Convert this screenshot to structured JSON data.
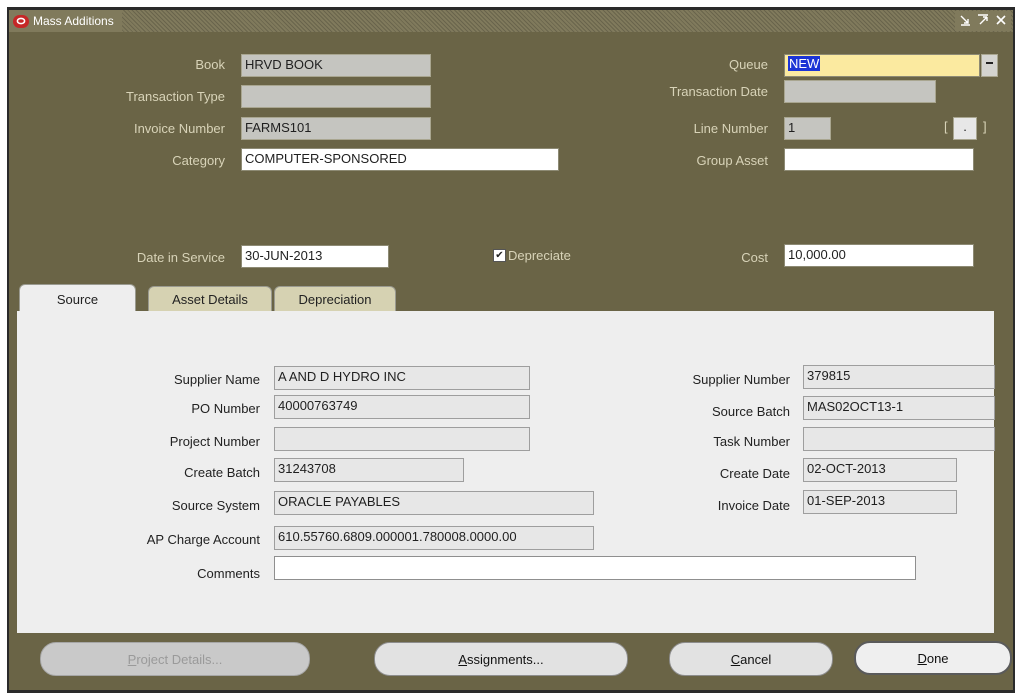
{
  "window": {
    "title": "Mass Additions",
    "controls": [
      "minimize",
      "maximize",
      "close"
    ]
  },
  "header": {
    "book_label": "Book",
    "book_value": "HRVD BOOK",
    "transaction_type_label": "Transaction Type",
    "transaction_type_value": "",
    "invoice_number_label": "Invoice Number",
    "invoice_number_value": "FARMS101",
    "category_label": "Category",
    "category_value": "COMPUTER-SPONSORED",
    "queue_label": "Queue",
    "queue_value": "NEW",
    "transaction_date_label": "Transaction Date",
    "transaction_date_value": "",
    "line_number_label": "Line Number",
    "line_number_value": "1",
    "group_asset_label": "Group Asset",
    "group_asset_value": "",
    "date_in_service_label": "Date in Service",
    "date_in_service_value": "30-JUN-2013",
    "depreciate_label": "Depreciate",
    "depreciate_checked": true,
    "cost_label": "Cost",
    "cost_value": "10,000.00"
  },
  "tabs": [
    {
      "label": "Source",
      "active": true
    },
    {
      "label": "Asset Details",
      "active": false
    },
    {
      "label": "Depreciation",
      "active": false
    }
  ],
  "source": {
    "supplier_name_label": "Supplier Name",
    "supplier_name_value": "A AND D HYDRO INC",
    "po_number_label": "PO Number",
    "po_number_value": "40000763749",
    "project_number_label": "Project Number",
    "project_number_value": "",
    "create_batch_label": "Create Batch",
    "create_batch_value": "31243708",
    "source_system_label": "Source System",
    "source_system_value": "ORACLE PAYABLES",
    "ap_charge_account_label": "AP Charge Account",
    "ap_charge_account_value": "610.55760.6809.000001.780008.0000.00",
    "comments_label": "Comments",
    "comments_value": "",
    "supplier_number_label": "Supplier Number",
    "supplier_number_value": "379815",
    "source_batch_label": "Source Batch",
    "source_batch_value": "MAS02OCT13-1",
    "task_number_label": "Task Number",
    "task_number_value": "",
    "create_date_label": "Create Date",
    "create_date_value": "02-OCT-2013",
    "invoice_date_label": "Invoice Date",
    "invoice_date_value": "01-SEP-2013"
  },
  "buttons": {
    "project_details": {
      "mnemonic": "P",
      "rest": "roject Details..."
    },
    "assignments": {
      "mnemonic": "A",
      "rest": "ssignments..."
    },
    "cancel": {
      "mnemonic": "C",
      "rest": "ancel"
    },
    "done": {
      "mnemonic": "D",
      "rest": "one"
    }
  },
  "colors": {
    "panel": "#6a6446",
    "titlebar": "#807a5c",
    "queue_highlight": "#fbeaa0",
    "selection": "#1c34d6"
  }
}
